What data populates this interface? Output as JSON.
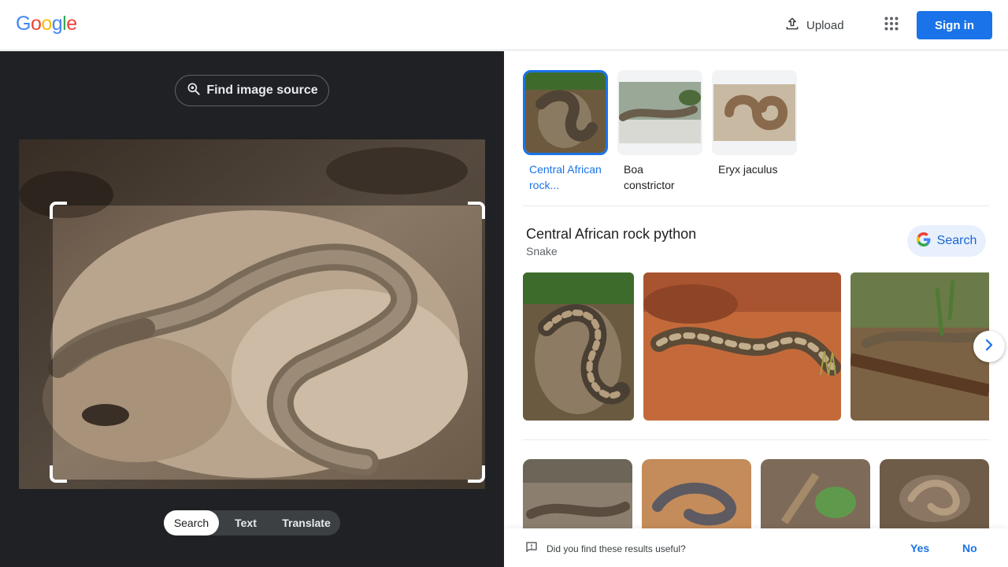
{
  "header": {
    "logo_letters": [
      {
        "char": "G",
        "color": "#4285F4"
      },
      {
        "char": "o",
        "color": "#EA4335"
      },
      {
        "char": "o",
        "color": "#FBBC05"
      },
      {
        "char": "g",
        "color": "#4285F4"
      },
      {
        "char": "l",
        "color": "#34A853"
      },
      {
        "char": "e",
        "color": "#EA4335"
      }
    ],
    "upload_label": "Upload",
    "signin_label": "Sign in",
    "upload_icon": "upload-icon",
    "apps_icon": "apps-grid-icon"
  },
  "left": {
    "find_source_label": "Find image source",
    "find_source_icon": "lens-search-icon",
    "modes": [
      {
        "label": "Search",
        "active": true
      },
      {
        "label": "Text",
        "active": false
      },
      {
        "label": "Translate",
        "active": false
      }
    ]
  },
  "right": {
    "entities": [
      {
        "label": "Central African rock...",
        "selected": true
      },
      {
        "label": "Boa constrictor",
        "selected": false
      },
      {
        "label": "Eryx jaculus",
        "selected": false
      }
    ],
    "knowledge": {
      "title": "Central African rock python",
      "subtitle": "Snake",
      "search_label": "Search"
    },
    "feedback": {
      "question": "Did you find these results useful?",
      "yes": "Yes",
      "no": "No"
    }
  },
  "colors": {
    "accent": "#1a73e8",
    "dark_pane": "#202124",
    "chip_bg": "#e8f0fe"
  }
}
